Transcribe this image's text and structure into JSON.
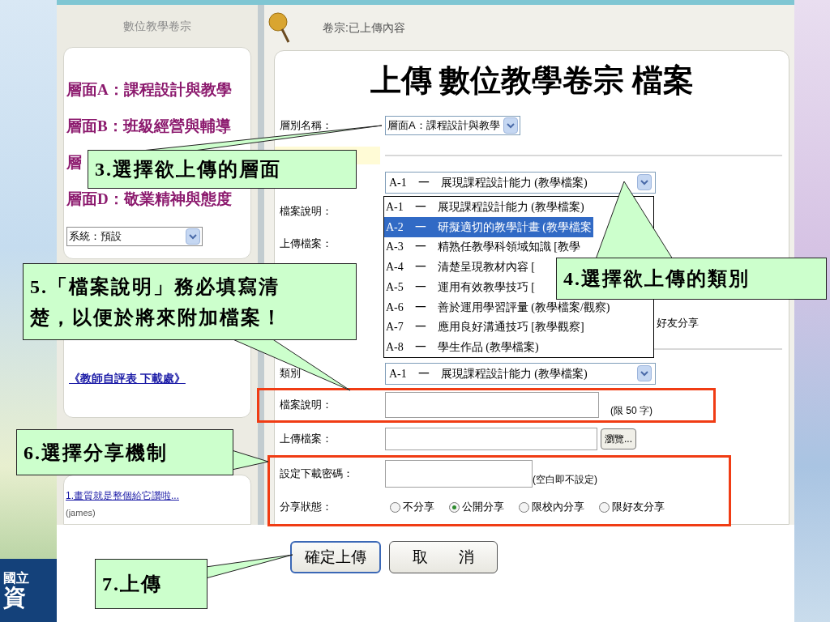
{
  "slide": {
    "logo_lines": [
      "國立",
      "資"
    ]
  },
  "sidebar": {
    "title": "數位教學卷宗",
    "levels": [
      {
        "label": "層面A：課程設計與教學"
      },
      {
        "label": "層面B：班級經營與輔導"
      },
      {
        "label": "層"
      },
      {
        "label": "層面D：敬業精神與態度"
      }
    ],
    "system_select": {
      "value": "系統：預設"
    },
    "link": "《教師自評表 下載處》",
    "messages": [
      {
        "title": "1.畫質就是整個給它讚啦...",
        "author": "(james)"
      }
    ]
  },
  "main": {
    "header": "卷宗:已上傳內容",
    "title": "上傳 數位教學卷宗 檔案",
    "level_field": {
      "label": "層別名稱：",
      "value": "層面A：課程設計與教學"
    },
    "category_select": {
      "code": "A-1",
      "dash": "一",
      "text": "展現課程設計能力 (教學檔案)"
    },
    "category_options": [
      {
        "code": "A-1",
        "dash": "一",
        "text": "展現課程設計能力 (教學檔案)",
        "selected": false
      },
      {
        "code": "A-2",
        "dash": "一",
        "text": "研擬適切的教學計畫 (教學檔案",
        "selected": true
      },
      {
        "code": "A-3",
        "dash": "一",
        "text": "精熟任教學科領域知識 [教學",
        "selected": false
      },
      {
        "code": "A-4",
        "dash": "一",
        "text": "清楚呈現教材內容 [",
        "selected": false
      },
      {
        "code": "A-5",
        "dash": "一",
        "text": "運用有效教學技巧 [",
        "selected": false
      },
      {
        "code": "A-6",
        "dash": "一",
        "text": "善於運用學習評量 (教學檔案/觀察)",
        "selected": false
      },
      {
        "code": "A-7",
        "dash": "一",
        "text": "應用良好溝通技巧 [教學觀察]",
        "selected": false
      },
      {
        "code": "A-8",
        "dash": "一",
        "text": "學生作品 (教學檔案)",
        "selected": false
      }
    ],
    "upper_labels": [
      "檔案說明：",
      "上傳檔案："
    ],
    "upper_fragment": "好友分享",
    "lower_form": {
      "category_label": "類別",
      "category_value": {
        "code": "A-1",
        "dash": "一",
        "text": "展現課程設計能力 (教學檔案)"
      },
      "description": {
        "label": "檔案說明：",
        "hint": "(限 50 字)"
      },
      "upload": {
        "label": "上傳檔案：",
        "browse": "瀏覽..."
      },
      "password": {
        "label": "設定下載密碼：",
        "hint": "(空白即不設定)"
      },
      "share": {
        "label": "分享狀態：",
        "options": [
          {
            "label": "不分享",
            "selected": false
          },
          {
            "label": "公開分享",
            "selected": true
          },
          {
            "label": "限校內分享",
            "selected": false
          },
          {
            "label": "限好友分享",
            "selected": false
          }
        ]
      }
    },
    "buttons": [
      {
        "label": "確定上傳",
        "default": true
      },
      {
        "label": "取　　消",
        "default": false
      }
    ]
  },
  "callouts": [
    {
      "lines": [
        "3.選擇欲上傳的層面"
      ]
    },
    {
      "lines": [
        "5.「檔案說明」務必填寫清",
        "楚，以便於將來附加檔案！"
      ]
    },
    {
      "lines": [
        "4.選擇欲上傳的類別"
      ]
    },
    {
      "lines": [
        "6.選擇分享機制"
      ]
    },
    {
      "lines": [
        "7.上傳"
      ]
    }
  ]
}
